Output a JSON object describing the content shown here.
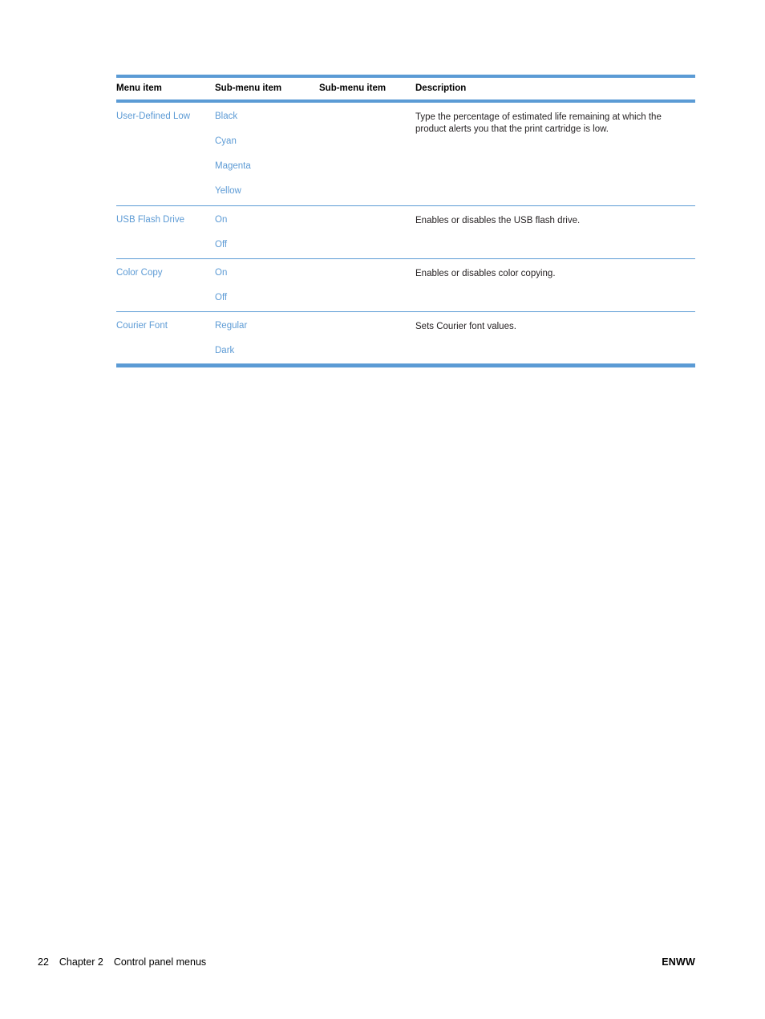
{
  "document": {
    "table": {
      "headers": [
        "Menu item",
        "Sub-menu item",
        "Sub-menu item",
        "Description"
      ],
      "rows": [
        {
          "menu_item": "User-Defined Low",
          "sub_menu_items": [
            "Black",
            "Cyan",
            "Magenta",
            "Yellow"
          ],
          "sub_menu_items_2": [],
          "description": "Type the percentage of estimated life remaining at which the product alerts you that the print cartridge is low."
        },
        {
          "menu_item": "USB Flash Drive",
          "sub_menu_items": [
            "On",
            "Off"
          ],
          "sub_menu_items_2": [],
          "description": "Enables or disables the USB flash drive."
        },
        {
          "menu_item": "Color Copy",
          "sub_menu_items": [
            "On",
            "Off"
          ],
          "sub_menu_items_2": [],
          "description": "Enables or disables color copying."
        },
        {
          "menu_item": "Courier Font",
          "sub_menu_items": [
            "Regular",
            "Dark"
          ],
          "sub_menu_items_2": [],
          "description": "Sets Courier font values."
        }
      ]
    },
    "footer": {
      "page_number": "22",
      "chapter": "Chapter 2",
      "chapter_title": "Control panel menus",
      "right_label": "ENWW"
    },
    "colors": {
      "rule": "#5b9bd5",
      "link_text": "#5d9bd5",
      "body_text": "#231f20"
    }
  }
}
